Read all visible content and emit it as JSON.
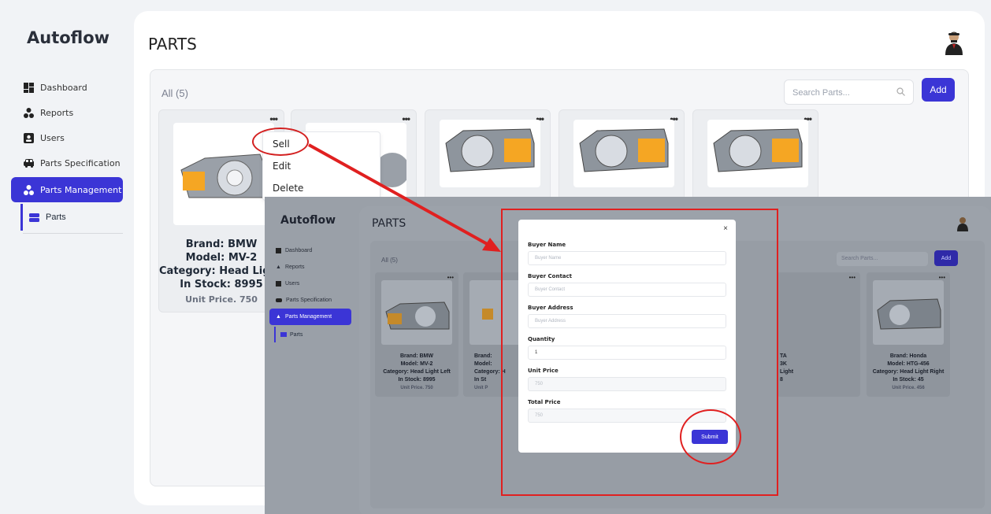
{
  "app": {
    "name": "Autoflow"
  },
  "sidebar": {
    "items": [
      {
        "label": "Dashboard",
        "icon": "dashboard-icon"
      },
      {
        "label": "Reports",
        "icon": "reports-icon"
      },
      {
        "label": "Users",
        "icon": "users-icon"
      },
      {
        "label": "Parts Specification",
        "icon": "car-icon"
      },
      {
        "label": "Parts Management",
        "icon": "parts-management-icon",
        "active": true
      }
    ],
    "sub_items": [
      {
        "label": "Parts",
        "icon": "parts-icon"
      }
    ]
  },
  "header": {
    "title": "PARTS"
  },
  "toolbar": {
    "filter_label": "All (5)",
    "search_placeholder": "Search Parts...",
    "add_label": "Add"
  },
  "colors": {
    "accent": "#3b35d6",
    "annotation": "#e02020",
    "headlight_amber": "#f5a623"
  },
  "cards": [
    {
      "brand": "Brand: BMW",
      "model": "Model: MV-2",
      "category": "Category: Head Light Left",
      "stock": "In Stock: 8995",
      "price": "Unit Price. 750"
    }
  ],
  "context_menu": {
    "items": [
      "Sell",
      "Edit",
      "Delete"
    ]
  },
  "overlay": {
    "app_name": "Autoflow",
    "title": "PARTS",
    "filter_label": "All (5)",
    "search_placeholder": "Search Parts...",
    "add_label": "Add",
    "sidebar": [
      "Dashboard",
      "Reports",
      "Users",
      "Parts Specification",
      "Parts Management"
    ],
    "sub_item": "Parts",
    "cards": [
      {
        "brand": "Brand: BMW",
        "model": "Model: MV-2",
        "category": "Category: Head Light Left",
        "stock": "In Stock: 8995",
        "price": "Unit Price. 750"
      },
      {
        "brand": "Brand:",
        "model": "Model:",
        "category": "Category: H",
        "stock": "In St",
        "price": "Unit P"
      },
      {
        "brand": "TA",
        "model": "3K",
        "category": "Light",
        "stock": "8",
        "price": ""
      },
      {
        "brand": "Brand: Honda",
        "model": "Model: HTG-456",
        "category": "Category: Head Light Right",
        "stock": "In Stock: 45",
        "price": "Unit Price. 456"
      }
    ]
  },
  "sell_form": {
    "buyer_name_label": "Buyer Name",
    "buyer_name_placeholder": "Buyer Name",
    "buyer_contact_label": "Buyer Contact",
    "buyer_contact_placeholder": "Buyer Contact",
    "buyer_address_label": "Buyer Address",
    "buyer_address_placeholder": "Buyer Address",
    "quantity_label": "Quantity",
    "quantity_value": "1",
    "unit_price_label": "Unit Price",
    "unit_price_value": "750",
    "total_price_label": "Total Price",
    "total_price_value": "750",
    "submit_label": "Submit",
    "close_label": "×"
  }
}
